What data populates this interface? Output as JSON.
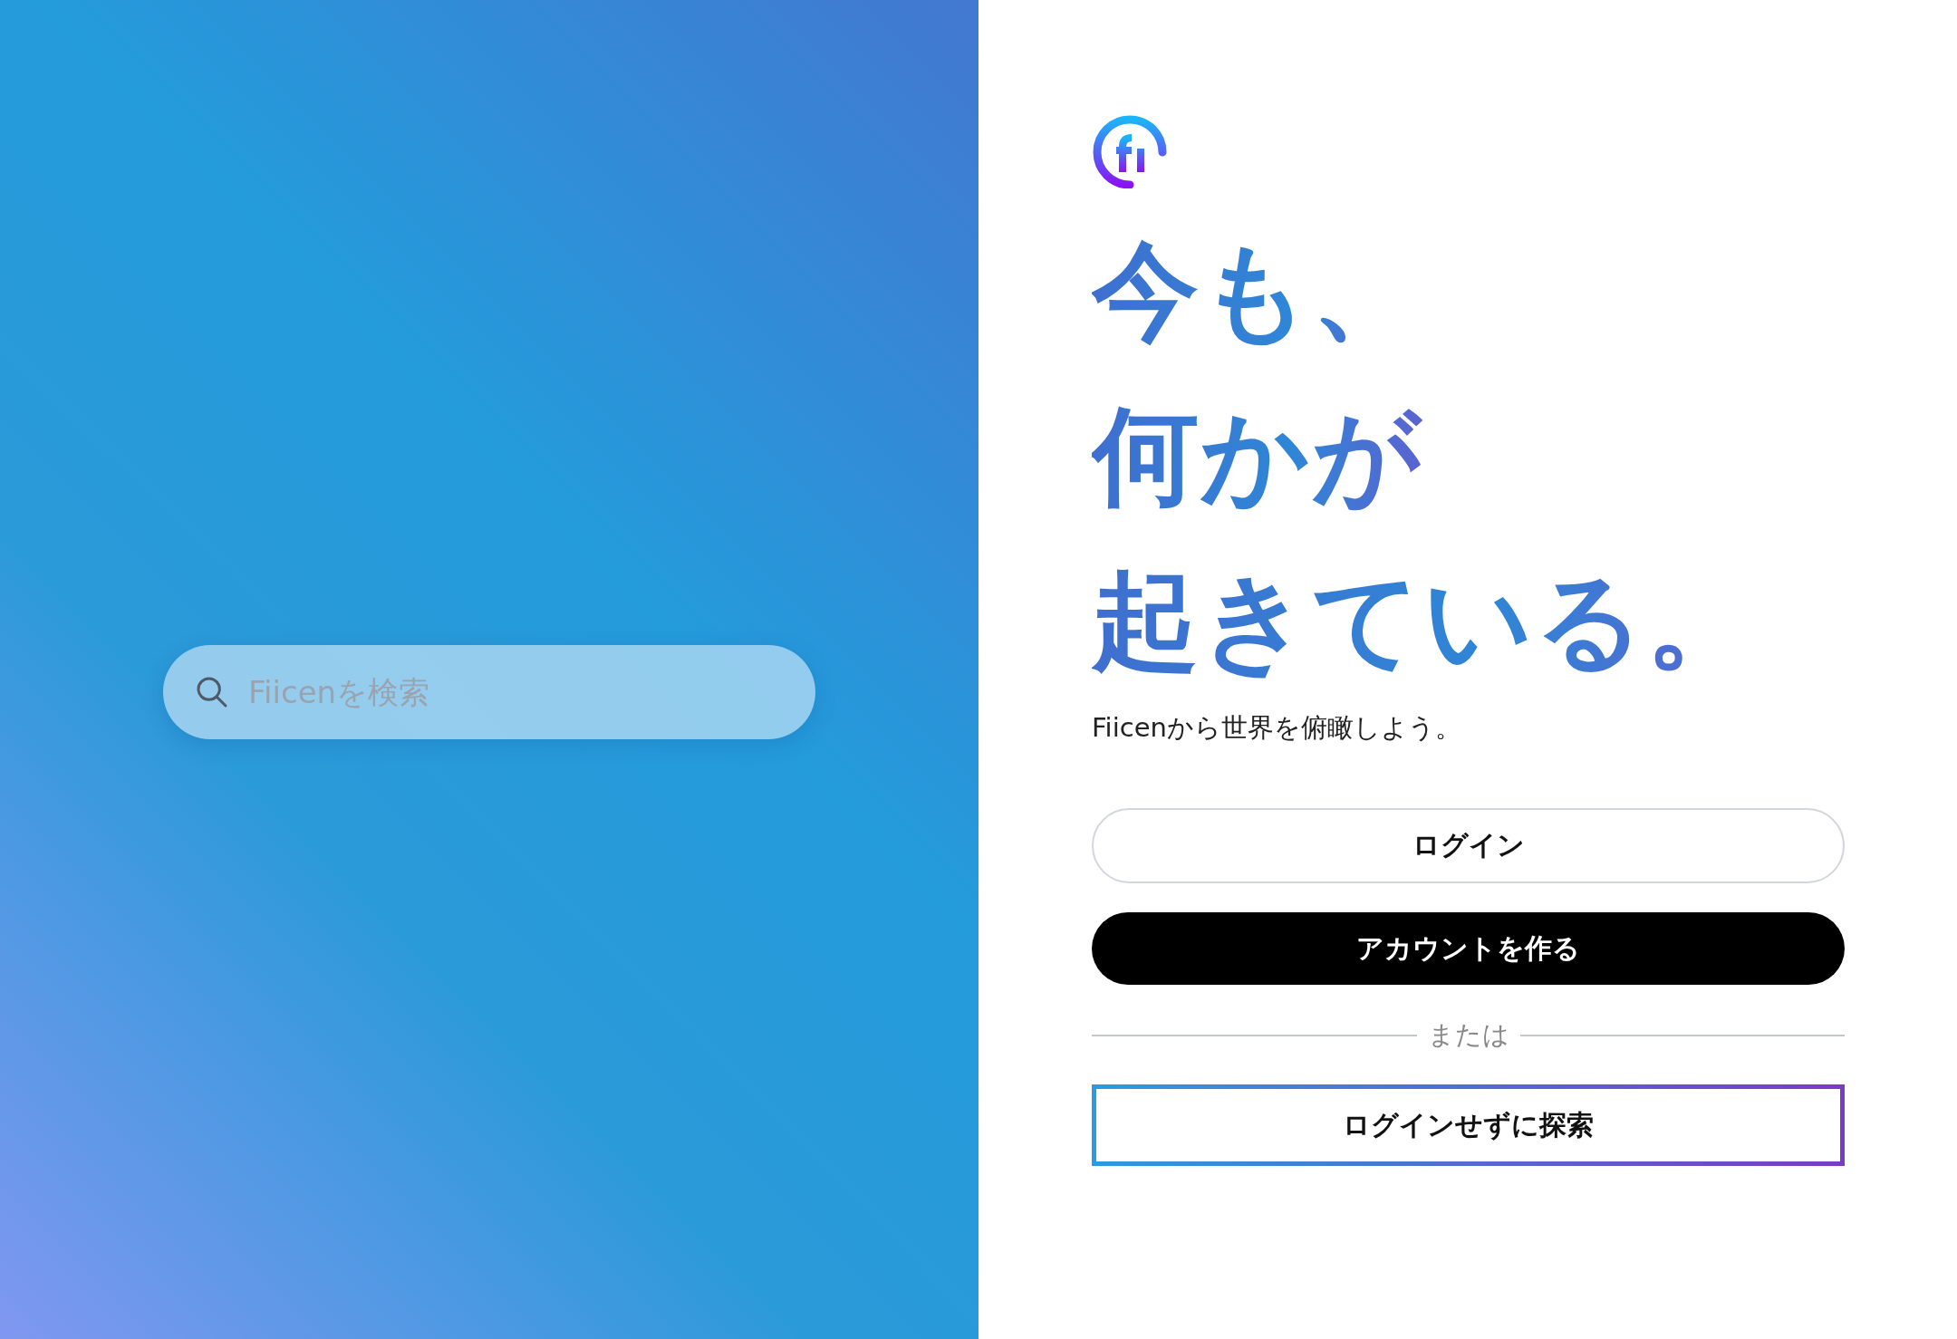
{
  "search": {
    "placeholder": "Fiicenを検索"
  },
  "headline": [
    "今も、",
    "何かが",
    "起きている。"
  ],
  "tagline": "Fiicenから世界を俯瞰しよう。",
  "buttons": [
    {
      "label": "ログイン",
      "kind": "outline"
    },
    {
      "label": "アカウントを作る",
      "kind": "filled"
    }
  ],
  "divider": "または",
  "explore_button": {
    "label": "ログインせずに探索"
  }
}
